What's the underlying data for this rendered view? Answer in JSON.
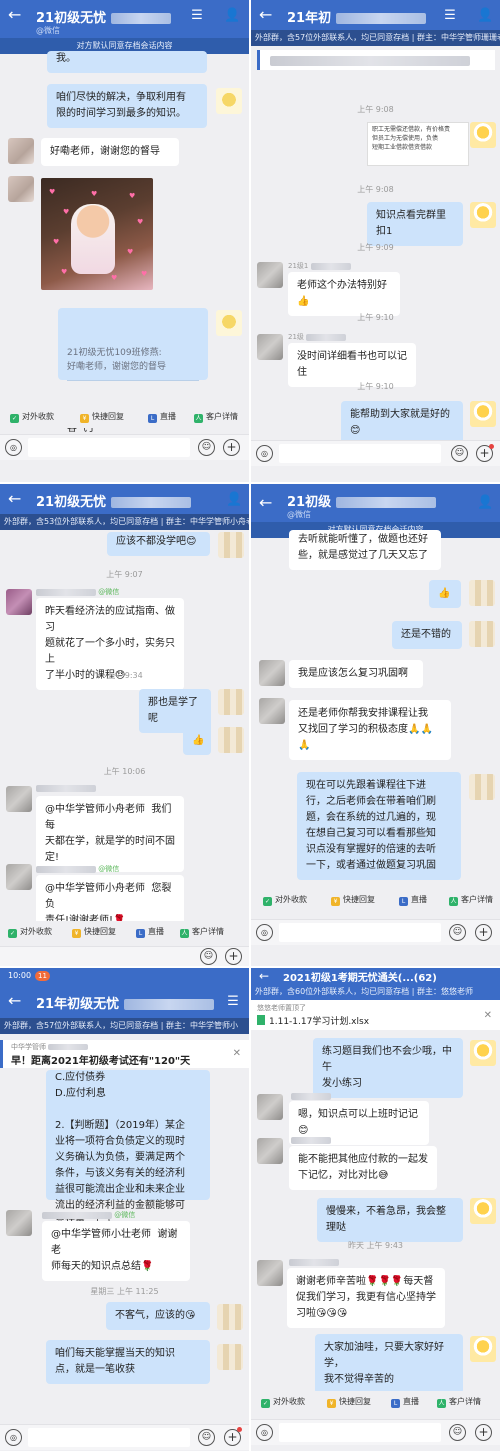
{
  "panels": [
    {
      "header": {
        "title": "21初级无忧",
        "sub": "@微信"
      },
      "notice": "对方默认同意存档会话内容",
      "messages": [
        {
          "text": "我。"
        },
        {
          "text": "咱们尽快的解决，争取利用有\n限的时间学习到最多的知识。"
        },
        {
          "text": "好嘞老师，谢谢您的督导"
        },
        {
          "quote": "21初级无忧109班修燕:\n好嘞老师，谢谢您的督导",
          "text": "客气了"
        }
      ],
      "toolbar": [
        "对外收款",
        "快捷回复",
        "直播",
        "客户详情"
      ]
    },
    {
      "header": {
        "title": "21年初",
        "sub": "外部群，含57位外部联系人，均已同意存档 | 群主：中华学管师珊珊老师"
      },
      "messages": [
        {
          "time": "上午 9:08"
        },
        {
          "doc": [
            "职工无需偿还借款，有价格责",
            "但员工为无偿使用，负债",
            "短期工业借款借资借款"
          ]
        },
        {
          "time": "上午 9:08"
        },
        {
          "text": "知识点看完群里扣1"
        },
        {
          "time": "上午 9:09"
        },
        {
          "name": "21级1",
          "text": "老师这个办法特别好👍"
        },
        {
          "time": "上午 9:10"
        },
        {
          "name": "21级",
          "text": "没时间详细看书也可以记住"
        },
        {
          "time": "上午 9:10"
        },
        {
          "text": "能帮助到大家就是好的😊"
        }
      ]
    },
    {
      "header": {
        "title": "21初级无忧",
        "sub": "外部群，含53位外部联系人，均已同意存档 | 群主：中华学管师小舟老师"
      },
      "messages": [
        {
          "text": "应该不都没学吧😊"
        },
        {
          "time": "上午 9:07"
        },
        {
          "name": "@微信",
          "text": "昨天看经济法的应试指南、做习\n题就花了一个多小时，实务只上\n了半小时的课程😓"
        },
        {
          "time": "上午 9:34"
        },
        {
          "text": "那也是学了呢"
        },
        {
          "text": "👍"
        },
        {
          "time": "上午 10:06"
        },
        {
          "text": "@中华学管师小舟老师  我们每\n天都在学，就是学的时间不固\n定!"
        },
        {
          "name": "@微信",
          "text": "@中华学管师小舟老师  您裂负\n责任!谢谢老师!🌹"
        }
      ],
      "toolbar": [
        "对外收款",
        "快捷回复",
        "直播",
        "客户详情"
      ]
    },
    {
      "header": {
        "title": "21初级",
        "sub": "@微信"
      },
      "notice": "对方默认同意存档会话内容",
      "messages": [
        {
          "text": "去听就能听懂了，做题也还好\n些，就是感觉过了几天又忘了"
        },
        {
          "text": "👍"
        },
        {
          "text": "还是不错的"
        },
        {
          "text": "我是应该怎么复习巩固啊"
        },
        {
          "text": "还是老师你帮我安排课程让我\n又找回了学习的积极态度🙏🙏\n🙏"
        },
        {
          "text": "现在可以先跟着课程往下进\n行，之后老师会在带着咱们刷\n题，会在系统的过几遍的，现\n在想自己复习可以看看那些知\n识点没有掌握好的倍速的去听\n一下，或者通过做题复习巩固"
        }
      ],
      "toolbar": [
        "对外收款",
        "快捷回复",
        "直播",
        "客户详情"
      ]
    },
    {
      "status": {
        "time": "10:00",
        "badge": "11"
      },
      "header": {
        "title": "21年初级无忧",
        "sub": "外部群，含57位外部联系人，均已同意存档 | 群主：中华学管师小"
      },
      "pinned": {
        "by": "中华学管师",
        "text": "早！距离2021年初级考试还有\"120\"天"
      },
      "messages": [
        {
          "text": "C.应付债券\nD.应付利息\n\n2.【判断题】（2019年）某企\n业将一项符合负债定义的现时\n义务确认为负债，要满足两个\n条件，与该义务有关的经济利\n益很可能流出企业和未来企业\n流出的经济利益的金额能够可\n靠计量。（  ）"
        },
        {
          "name": "@微信",
          "text": "@中华学管师小壮老师  谢谢老\n师每天的知识点总结🌹"
        },
        {
          "time": "星期三  上午 11:25"
        },
        {
          "text": "不客气，应该的😘"
        },
        {
          "text": "咱们每天能掌握当天的知识\n点，就是一笔收获"
        }
      ]
    },
    {
      "header": {
        "title": "2021初级1考期无忧通关(...(62)",
        "sub": "外部群，含60位外部联系人，均已同意存档 | 群主：悠悠老师"
      },
      "pinned": {
        "by": "悠悠老师置顶了",
        "file": "1.11-1.17学习计划.xlsx"
      },
      "messages": [
        {
          "text": "练习题目我们也不会少哦，中午\n发小练习"
        },
        {
          "text": "嗯，知识点可以上班时记记😊"
        },
        {
          "text": "能不能把其他应付款的一起发\n下记忆，对比对比😅"
        },
        {
          "text": "慢慢来，不着急昂，我会整理哒"
        },
        {
          "time": "昨天  上午 9:43"
        },
        {
          "text": "谢谢老师辛苦啦🌹🌹🌹每天督\n促我们学习，我更有信心坚持学\n习啦😘😘😘"
        },
        {
          "text": "大家加油哇，只要大家好好学，\n我不觉得辛苦的"
        }
      ],
      "toolbar": [
        "对外收款",
        "快捷回复",
        "直播",
        "客户详情"
      ]
    }
  ],
  "icons": {
    "back": "←",
    "user": "👤",
    "menu": "≡",
    "voice": "◎",
    "emoji": "☺",
    "plus": "+"
  }
}
